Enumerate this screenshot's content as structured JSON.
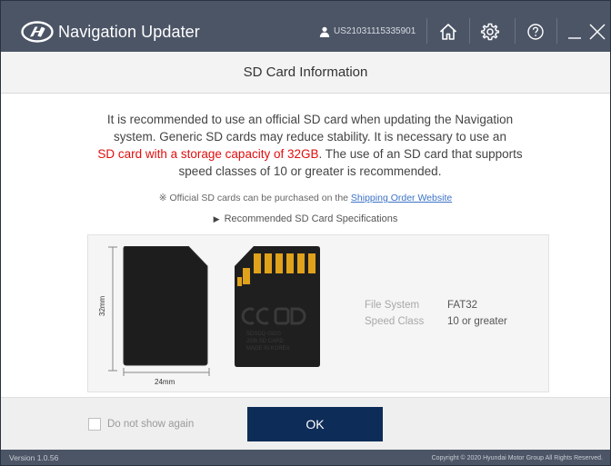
{
  "window": {
    "app_title": "Navigation Updater",
    "user_id": "US21031115335901",
    "icons": [
      "hyundai-logo",
      "user-icon",
      "home-icon",
      "gear-icon",
      "help-icon",
      "minimize-icon",
      "close-icon"
    ]
  },
  "section": {
    "title": "SD Card Information"
  },
  "message": {
    "line1": "It is recommended to use an official SD card when updating the Navigation",
    "line2": "system. Generic SD cards may reduce stability. It is necessary to use an",
    "line3_red": "SD card with a storage capacity of 32GB",
    "line3_rest": ". The use of an SD card that supports",
    "line4": "speed classes of 10 or greater is recommended."
  },
  "official_note": {
    "prefix": "※ Official SD cards can be purchased on the ",
    "link": "Shipping Order Website"
  },
  "spec_toggle": {
    "label": "Recommended SD Card Specifications"
  },
  "specs": {
    "height_label": "32mm",
    "width_label": "24mm",
    "card_back_text": [
      "SDSDQ-032G",
      "2GB SD CARD",
      "MADE IN KOREA"
    ],
    "rows": [
      {
        "label": "File System",
        "value": "FAT32"
      },
      {
        "label": "Speed Class",
        "value": "10 or greater"
      }
    ]
  },
  "footer": {
    "checkbox_label": "Do not show again",
    "checkbox_checked": false,
    "ok_label": "OK"
  },
  "status": {
    "version": "Version 1.0.56",
    "copyright": "Copyright © 2020 Hyundai Motor Group All Rights Reserved."
  },
  "colors": {
    "titlebar": "#4c5566",
    "ok_button": "#0e2c58",
    "highlight_red": "#e10e0e",
    "link_blue": "#3b72c7"
  }
}
